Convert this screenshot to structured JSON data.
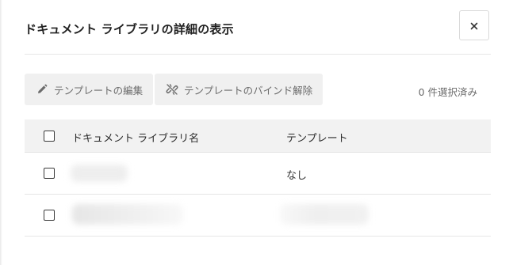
{
  "dialog": {
    "title": "ドキュメント ライブラリの詳細の表示",
    "close_symbol": "×"
  },
  "toolbar": {
    "edit_template_label": "テンプレートの編集",
    "unbind_template_label": "テンプレートのバインド解除",
    "selected_count_text": "0 件選択済み"
  },
  "table": {
    "headers": {
      "name": "ドキュメント ライブラリ名",
      "template": "テンプレート"
    },
    "rows": [
      {
        "name": "",
        "template": "なし"
      },
      {
        "name": "",
        "template": ""
      }
    ]
  },
  "icons": {
    "close": "close-icon",
    "edit": "pencil-icon",
    "unbind": "unlink-icon"
  },
  "colors": {
    "button_bg": "#f0f0f0",
    "header_row_bg": "#f2f2f2",
    "muted_text": "#6b6b6b"
  }
}
